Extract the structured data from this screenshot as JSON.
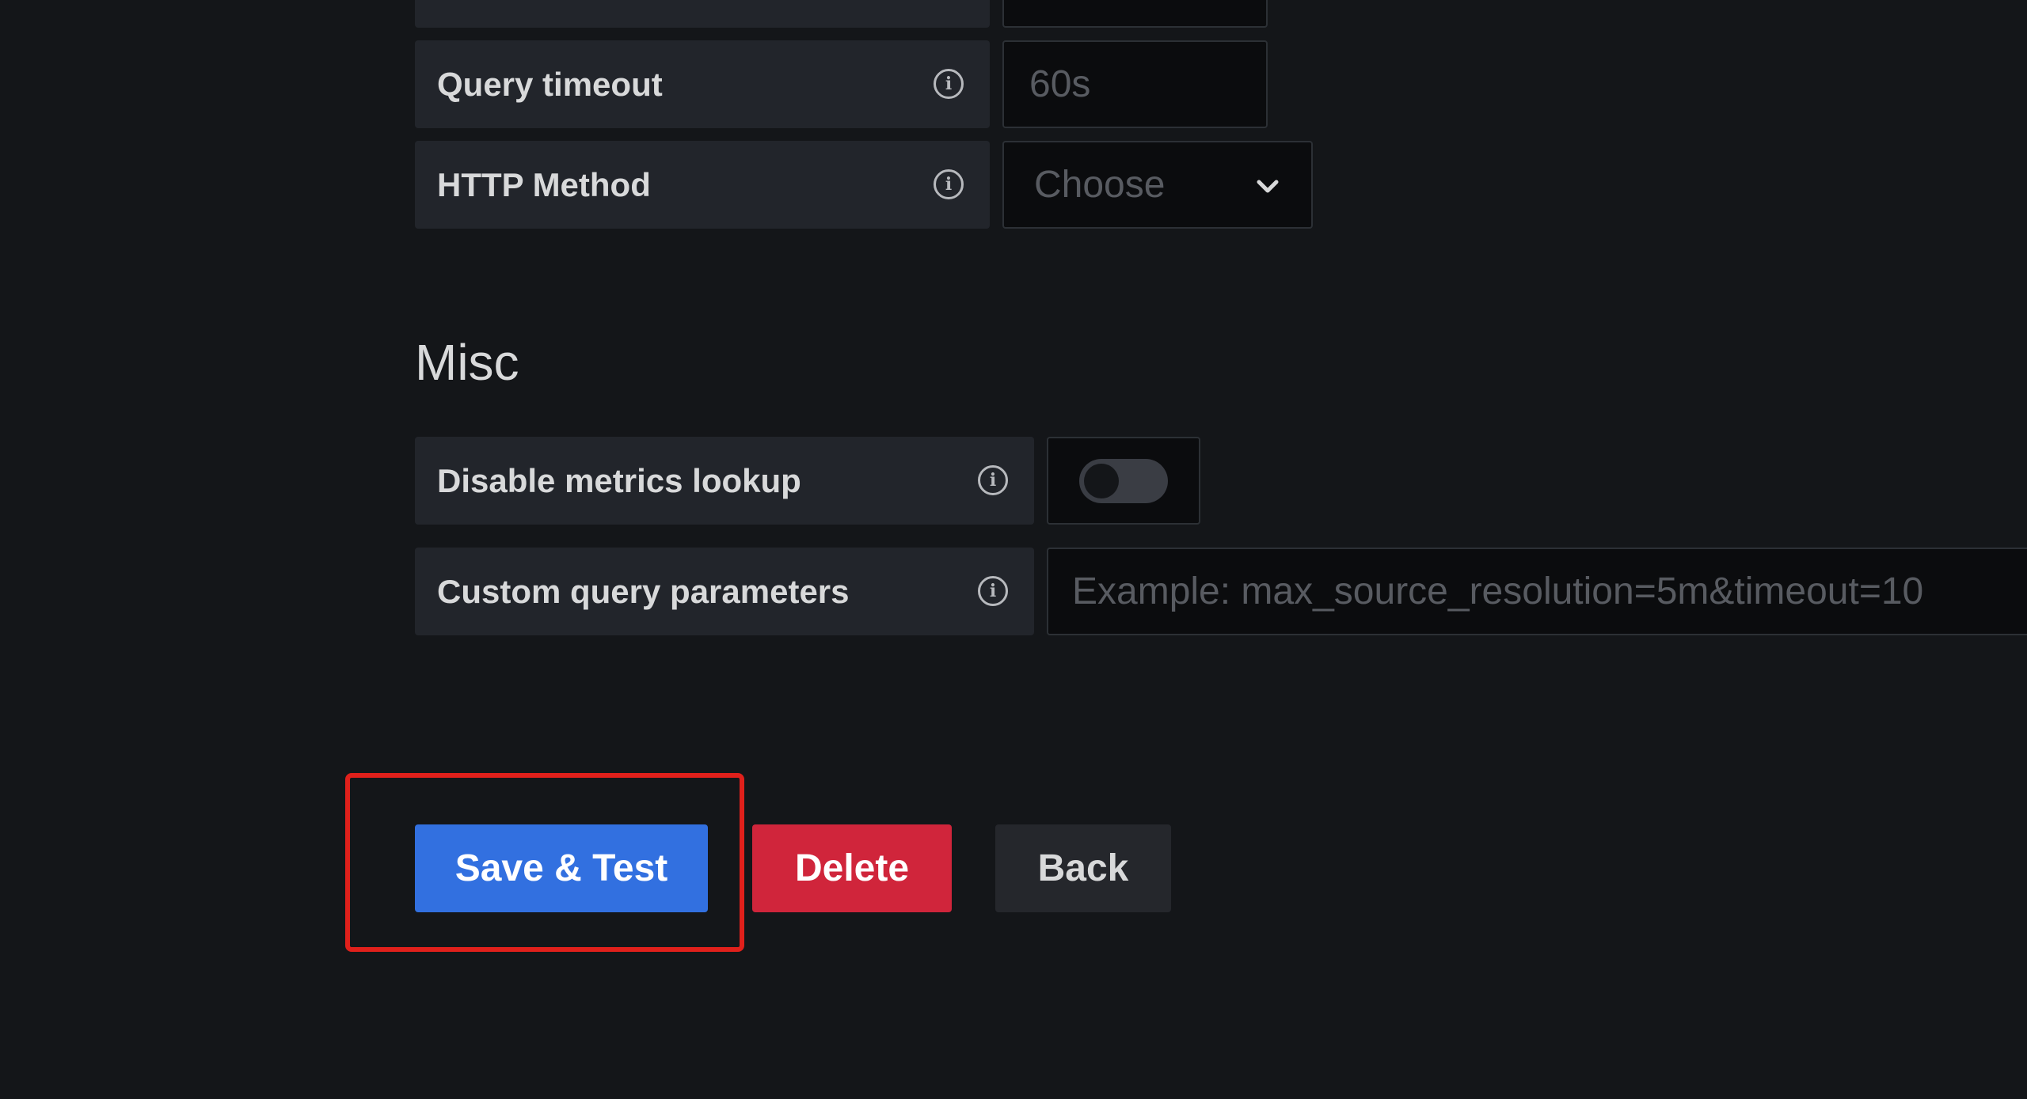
{
  "connection": {
    "query_timeout": {
      "label": "Query timeout",
      "placeholder": "60s"
    },
    "http_method": {
      "label": "HTTP Method",
      "placeholder": "Choose"
    }
  },
  "misc": {
    "heading": "Misc",
    "disable_metrics_lookup": {
      "label": "Disable metrics lookup",
      "enabled": false
    },
    "custom_query_parameters": {
      "label": "Custom query parameters",
      "placeholder": "Example: max_source_resolution=5m&timeout=10"
    }
  },
  "actions": {
    "save_test_label": "Save & Test",
    "delete_label": "Delete",
    "back_label": "Back",
    "highlight_color": "#e0201b"
  },
  "colors": {
    "background": "#141619",
    "primary": "#3270e0",
    "destructive": "#d0253b",
    "secondary": "#25272c"
  }
}
